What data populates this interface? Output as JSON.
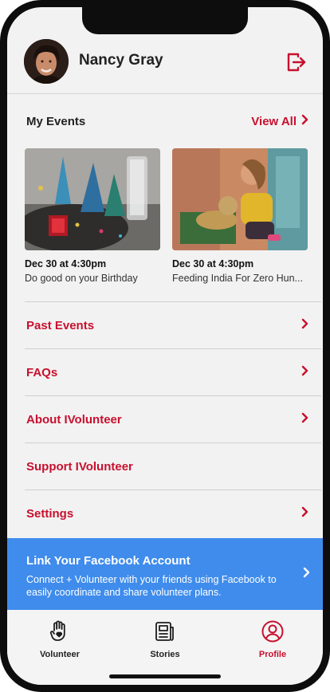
{
  "profile": {
    "name": "Nancy Gray"
  },
  "my_events": {
    "title": "My Events",
    "view_all": "View All",
    "events": [
      {
        "date": "Dec 30 at 4:30pm",
        "title": "Do good on your Birthday"
      },
      {
        "date": "Dec 30 at 4:30pm",
        "title": "Feeding India For Zero Hun..."
      }
    ]
  },
  "menu": [
    {
      "label": "Past Events",
      "chevron": true
    },
    {
      "label": "FAQs",
      "chevron": true
    },
    {
      "label": "About IVolunteer",
      "chevron": true
    },
    {
      "label": "Support IVolunteer",
      "chevron": false
    },
    {
      "label": "Settings",
      "chevron": true
    }
  ],
  "facebook": {
    "title": "Link Your Facebook Account",
    "description": "Connect + Volunteer with your friends using Facebook to easily coordinate and share volunteer plans."
  },
  "tabs": [
    {
      "label": "Volunteer",
      "icon": "hand-heart-icon",
      "active": false
    },
    {
      "label": "Stories",
      "icon": "newspaper-icon",
      "active": false
    },
    {
      "label": "Profile",
      "icon": "user-circle-icon",
      "active": true
    }
  ],
  "colors": {
    "accent": "#c8102e",
    "facebook_blue": "#3f8cec",
    "background": "#f2f2f2"
  }
}
